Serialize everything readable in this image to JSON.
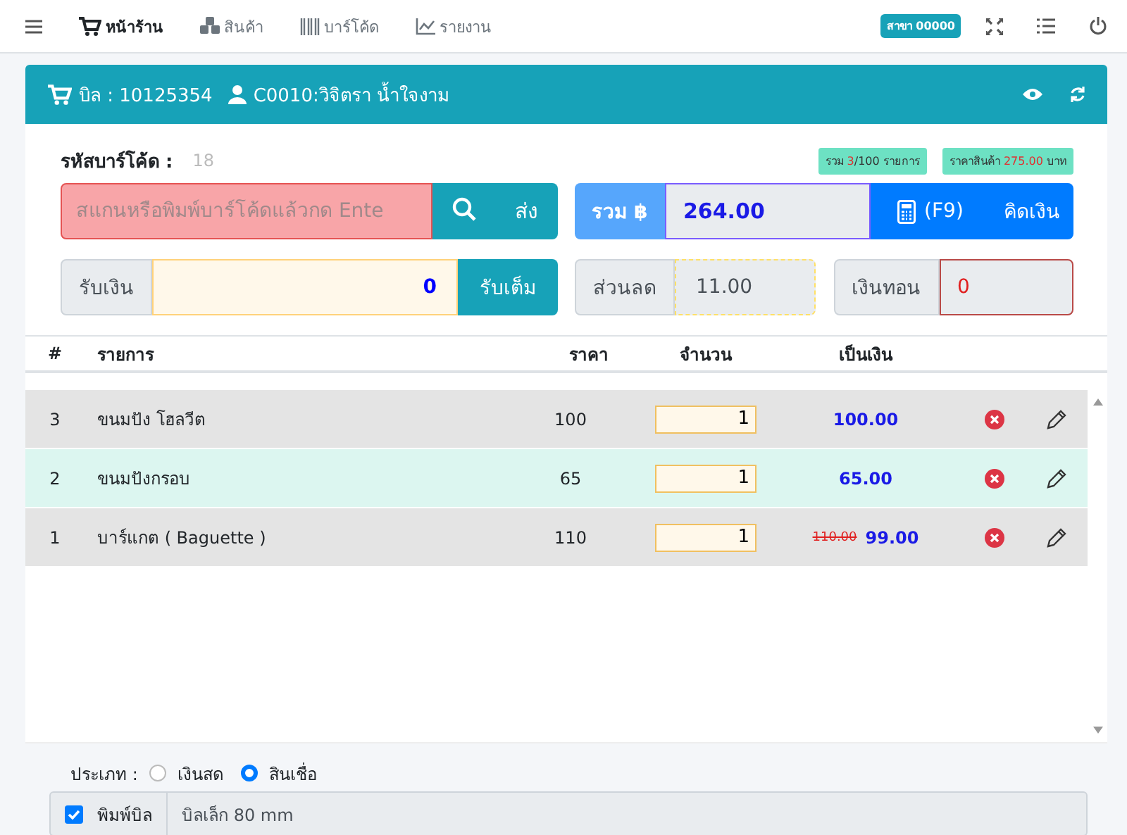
{
  "nav": {
    "items": [
      {
        "label": "หน้าร้าน",
        "selected": true
      },
      {
        "label": "สินค้า",
        "selected": false
      },
      {
        "label": "บาร์โค้ด",
        "selected": false
      },
      {
        "label": "รายงาน",
        "selected": false
      }
    ],
    "branch": "สาขา 00000"
  },
  "bill": {
    "label": "บิล : 10125354",
    "customer": "C0010:วิจิตรา น้ำใจงาม"
  },
  "barcode": {
    "label": "รหัสบาร์โค้ด :",
    "count": "18",
    "placeholder": "สแกนหรือพิมพ์บาร์โค้ดแล้วกด Ente",
    "send": "ส่ง"
  },
  "badges": [
    {
      "prefix": "รวม ",
      "value": "3",
      "suffix": "/100 รายการ"
    },
    {
      "prefix": "ราคาสินค้า ",
      "value": "275.00",
      "suffix": " บาท"
    }
  ],
  "total": {
    "label": "รวม ฿",
    "value": "264.00",
    "shortcut": "(F9)",
    "checkout": "คิดเงิน"
  },
  "receive": {
    "label": "รับเงิน",
    "value": "0",
    "full": "รับเต็ม"
  },
  "discount": {
    "label": "ส่วนลด",
    "value": "11.00"
  },
  "change": {
    "label": "เงินทอน",
    "value": "0"
  },
  "table": {
    "columns": [
      "#",
      "รายการ",
      "ราคา",
      "จำนวน",
      "เป็นเงิน"
    ],
    "rows": [
      {
        "no": "3",
        "name": "ขนมปัง โฮลวีต",
        "price": "100",
        "qty": "1",
        "amount": "100.00",
        "selected": false
      },
      {
        "no": "2",
        "name": "ขนมปังกรอบ",
        "price": "65",
        "qty": "1",
        "amount": "65.00",
        "selected": true
      },
      {
        "no": "1",
        "name": "บาร์แกต ( Baguette )",
        "price": "110",
        "qty": "1",
        "old_amount": "110.00",
        "amount": "99.00",
        "selected": false
      }
    ]
  },
  "payment_type": {
    "label": "ประเภท :",
    "options": [
      {
        "label": "เงินสด",
        "selected": false
      },
      {
        "label": "สินเชื่อ",
        "selected": true
      }
    ]
  },
  "print": {
    "label": "พิมพ์บิล",
    "checked": true,
    "size": "บิลเล็ก 80 mm"
  }
}
